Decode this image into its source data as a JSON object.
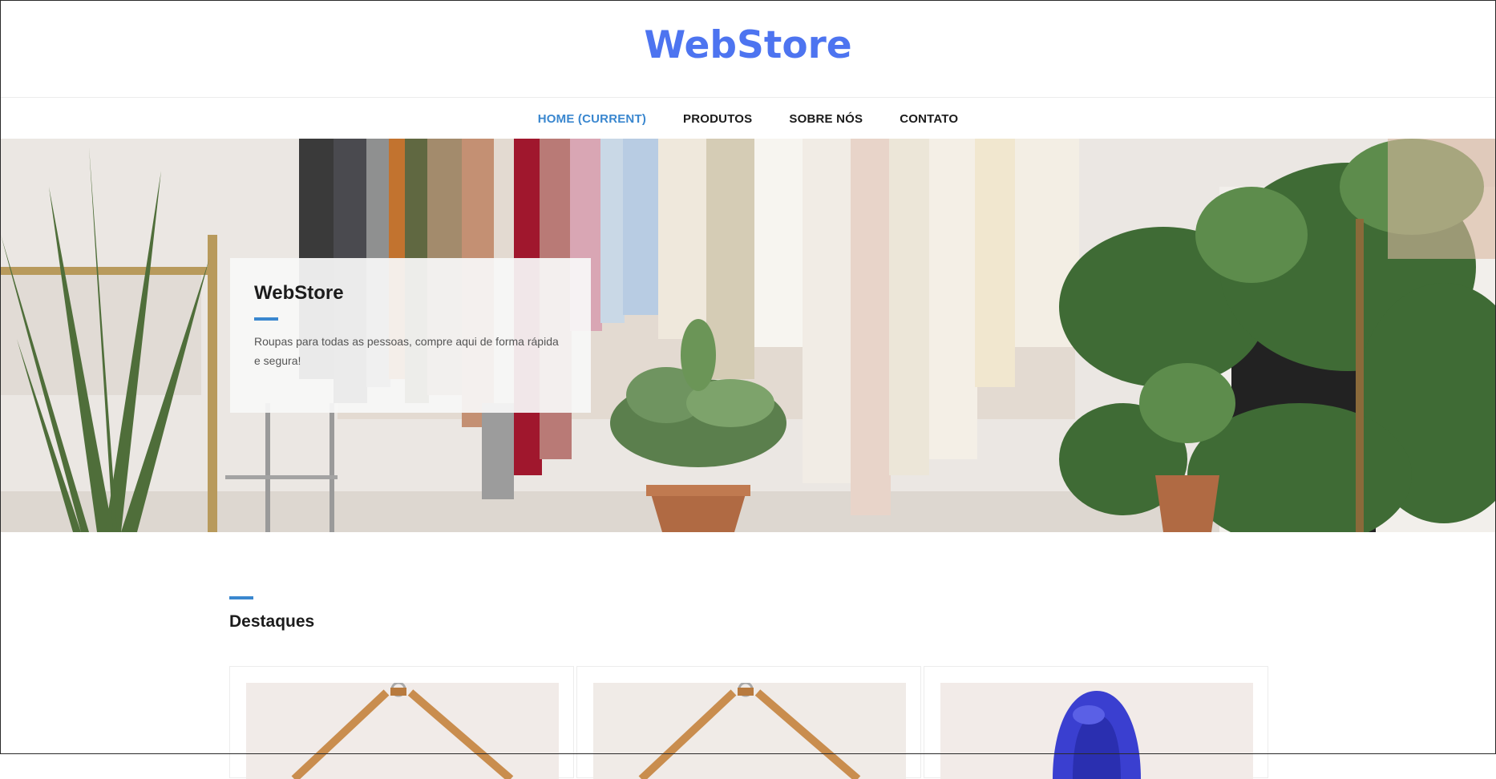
{
  "header": {
    "logo": "WebStore"
  },
  "nav": {
    "items": [
      {
        "label": "HOME (CURRENT)",
        "current": true
      },
      {
        "label": "PRODUTOS",
        "current": false
      },
      {
        "label": "SOBRE NÓS",
        "current": false
      },
      {
        "label": "CONTATO",
        "current": false
      }
    ]
  },
  "hero": {
    "title": "WebStore",
    "text": "Roupas para todas as pessoas, compre aqui de forma rápida e segura!"
  },
  "featured": {
    "title": "Destaques",
    "cards": [
      {
        "image": "hanger-shirt-photo"
      },
      {
        "image": "hanger-shirt-photo"
      },
      {
        "image": "blue-hoodie-photo"
      }
    ]
  },
  "colors": {
    "brand": "#4d74f0",
    "accent": "#3a87cf",
    "text": "#1c1c1c"
  }
}
